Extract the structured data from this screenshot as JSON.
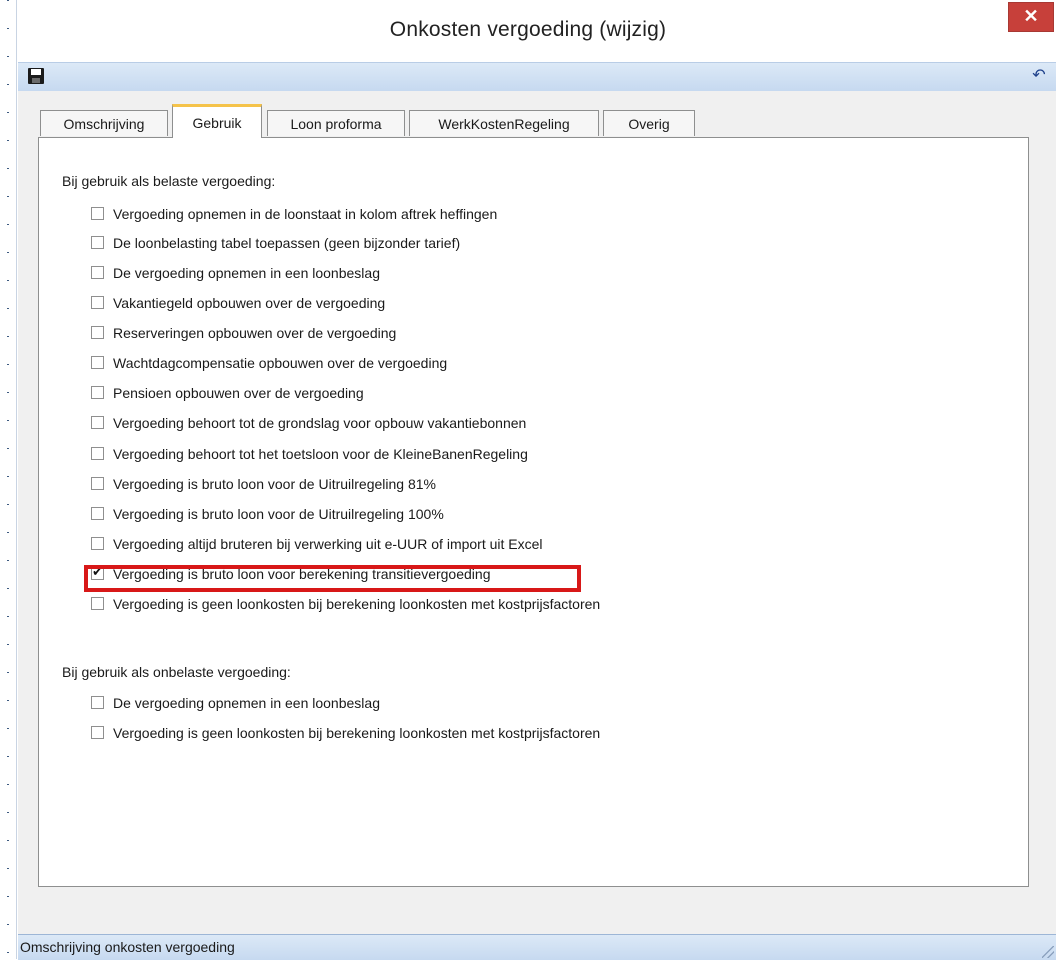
{
  "window": {
    "title": "Onkosten vergoeding  (wijzig)",
    "close_glyph": "✕"
  },
  "toolbar": {
    "save_icon": "save-icon",
    "undo_icon": "undo-icon",
    "undo_glyph": "↶"
  },
  "tabs": [
    {
      "label": "Omschrijving",
      "active": false
    },
    {
      "label": "Gebruik",
      "active": true
    },
    {
      "label": "Loon proforma",
      "active": false
    },
    {
      "label": "WerkKostenRegeling",
      "active": false
    },
    {
      "label": "Overig",
      "active": false
    }
  ],
  "taxed_section": {
    "title": "Bij gebruik als belaste vergoeding:",
    "options": [
      {
        "label": "Vergoeding opnemen in de loonstaat in kolom aftrek heffingen",
        "checked": false
      },
      {
        "label": "De loonbelasting tabel toepassen (geen bijzonder tarief)",
        "checked": false
      },
      {
        "label": "De vergoeding opnemen in een loonbeslag",
        "checked": false
      },
      {
        "label": "Vakantiegeld opbouwen over de vergoeding",
        "checked": false
      },
      {
        "label": "Reserveringen opbouwen over de vergoeding",
        "checked": false
      },
      {
        "label": "Wachtdagcompensatie opbouwen over de vergoeding",
        "checked": false
      },
      {
        "label": "Pensioen opbouwen over de vergoeding",
        "checked": false
      },
      {
        "label": "Vergoeding behoort tot de grondslag voor opbouw vakantiebonnen",
        "checked": false
      },
      {
        "label": "Vergoeding behoort tot het toetsloon voor de KleineBanenRegeling",
        "checked": false
      },
      {
        "label": "Vergoeding is bruto loon voor de Uitruilregeling 81%",
        "checked": false
      },
      {
        "label": "Vergoeding is bruto loon voor de Uitruilregeling 100%",
        "checked": false
      },
      {
        "label": "Vergoeding altijd bruteren bij verwerking uit e-UUR of import uit Excel",
        "checked": false
      },
      {
        "label": "Vergoeding is bruto loon voor berekening transitievergoeding",
        "checked": true
      },
      {
        "label": "Vergoeding is geen loonkosten bij berekening loonkosten met kostprijsfactoren",
        "checked": false
      }
    ]
  },
  "untaxed_section": {
    "title": "Bij gebruik als onbelaste vergoeding:",
    "options": [
      {
        "label": "De vergoeding opnemen in een loonbeslag",
        "checked": false
      },
      {
        "label": "Vergoeding is geen loonkosten bij berekening loonkosten met kostprijsfactoren",
        "checked": false
      }
    ]
  },
  "statusbar": {
    "text": "Omschrijving onkosten vergoeding"
  },
  "colors": {
    "highlight": "#d81818",
    "close_button": "#c7403a",
    "active_tab_accent": "#f5c34a",
    "bar_blue": "#c6d9f0"
  }
}
